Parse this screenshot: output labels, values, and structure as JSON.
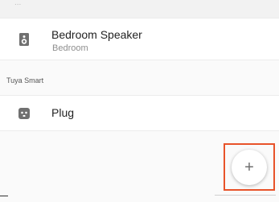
{
  "top_section": {
    "label": "..."
  },
  "devices": [
    {
      "name": "Bedroom Speaker",
      "room": "Bedroom",
      "icon": "speaker-icon"
    },
    {
      "name": "Plug",
      "icon": "plug-icon"
    }
  ],
  "section": {
    "label": "Tuya Smart"
  },
  "fab": {
    "icon": "plus-icon",
    "symbol": "+",
    "highlight_color": "#e8532a"
  }
}
